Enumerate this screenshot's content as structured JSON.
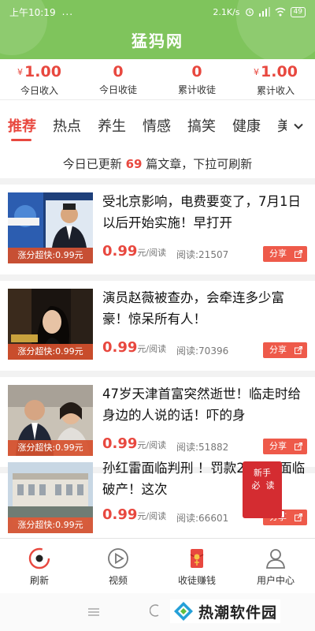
{
  "status_bar": {
    "time": "上午10:19",
    "dots": "...",
    "network_speed": "2.1K/s",
    "battery": "49"
  },
  "app": {
    "title": "猛犸网"
  },
  "stats": [
    {
      "currency": "¥",
      "value": "1.00",
      "label": "今日收入"
    },
    {
      "currency": "",
      "value": "0",
      "label": "今日收徒"
    },
    {
      "currency": "",
      "value": "0",
      "label": "累计收徒"
    },
    {
      "currency": "¥",
      "value": "1.00",
      "label": "累计收入"
    }
  ],
  "tabs": [
    "推荐",
    "热点",
    "养生",
    "情感",
    "搞笑",
    "健康",
    "美"
  ],
  "active_tab": "推荐",
  "notice": {
    "prefix": "今日已更新",
    "count": "69",
    "suffix": "篇文章，下拉可刷新"
  },
  "articles": [
    {
      "headline": "受北京影响，电费要变了，7月1日以后开始实施！早打开",
      "badge": "涨分超快:0.99元",
      "price": "0.99",
      "price_unit": "元/阅读",
      "reads": "阅读:21507",
      "share": "分享"
    },
    {
      "headline": "演员赵薇被查办，会牵连多少富豪！惊呆所有人！",
      "badge": "涨分超快:0.99元",
      "price": "0.99",
      "price_unit": "元/阅读",
      "reads": "阅读:70396",
      "share": "分享"
    },
    {
      "headline": "47岁天津首富突然逝世！临走时给身边的人说的话！吓的身",
      "badge": "涨分超快:0.99元",
      "price": "0.99",
      "price_unit": "元/阅读",
      "reads": "阅读:51882",
      "share": "分享"
    },
    {
      "headline": "孙红雷面临判刑 ！罚款20亿，面临破产！这次",
      "badge": "涨分超快:0.99元",
      "price": "0.99",
      "price_unit": "元/阅读",
      "reads": "阅读:66601",
      "share": "分享"
    }
  ],
  "sticker": {
    "line1": "新手",
    "line2": "必",
    "line3": "读"
  },
  "bottom_nav": [
    {
      "label": "刷新",
      "icon": "refresh-icon"
    },
    {
      "label": "视频",
      "icon": "play-icon"
    },
    {
      "label": "收徒赚钱",
      "icon": "red-envelope-icon"
    },
    {
      "label": "用户中心",
      "icon": "user-icon"
    }
  ],
  "watermark": {
    "text": "热潮软件园"
  },
  "colors": {
    "header_green": "#7fc45c",
    "accent_red": "#e8483f",
    "badge_orange": "#d6502e"
  }
}
